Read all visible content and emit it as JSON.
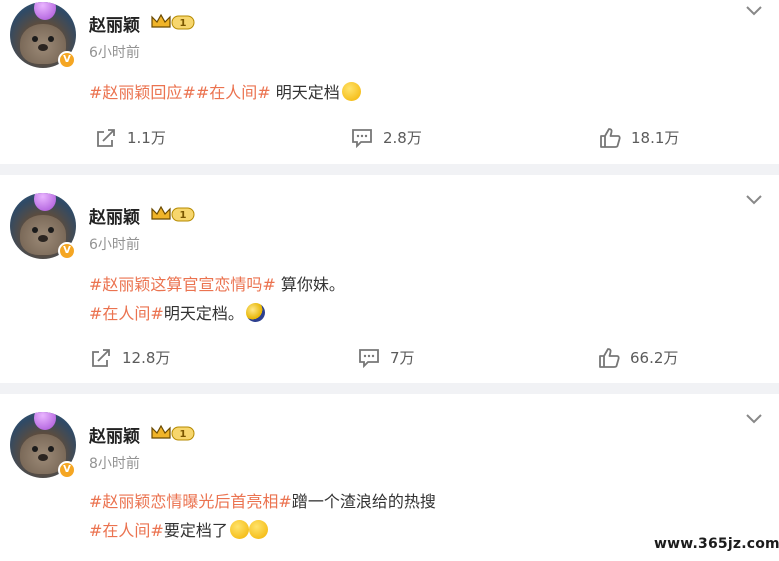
{
  "posts": [
    {
      "author": "赵丽颖",
      "level_badge": "1",
      "time": "6小时前",
      "lines": [
        {
          "tags": "#赵丽颖回应##在人间#",
          "text": " 明天定档"
        }
      ],
      "actions": {
        "share": "1.1万",
        "comment": "2.8万",
        "like": "18.1万"
      }
    },
    {
      "author": "赵丽颖",
      "level_badge": "1",
      "time": "6小时前",
      "lines": [
        {
          "tags": "#赵丽颖这算官宣恋情吗#",
          "text": " 算你妹。"
        },
        {
          "tags": "#在人间#",
          "text": "明天定档。"
        }
      ],
      "actions": {
        "share": "12.8万",
        "comment": "7万",
        "like": "66.2万"
      }
    },
    {
      "author": "赵丽颖",
      "level_badge": "1",
      "time": "8小时前",
      "lines": [
        {
          "tags": "#赵丽颖恋情曝光后首亮相#",
          "text": "蹭一个渣浪给的热搜"
        },
        {
          "tags": "#在人间#",
          "text": "要定档了"
        }
      ]
    }
  ],
  "verified_mark": "V",
  "watermark": "www.365jz.com",
  "colors": {
    "topic": "#eb7350",
    "separator": "#f1f2f5",
    "badge": "#f5a623"
  }
}
